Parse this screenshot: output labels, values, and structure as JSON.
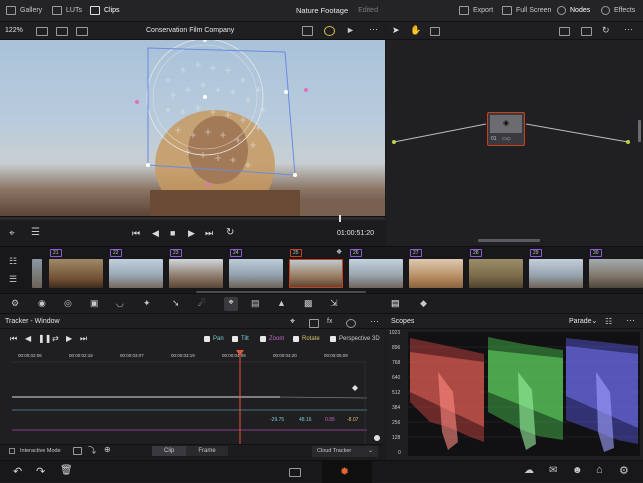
{
  "topbar": {
    "gallery": "Gallery",
    "luts": "LUTs",
    "clips": "Clips",
    "project_title": "Nature Footage",
    "project_status": "Edited",
    "export": "Export",
    "fullscreen": "Full Screen",
    "nodes": "Nodes",
    "effects": "Effects"
  },
  "viewer": {
    "zoom": "122%",
    "clip_name": "Conservation Film Company",
    "timecode": "01:00:51:20"
  },
  "clips": [
    {
      "num": "21"
    },
    {
      "num": "22"
    },
    {
      "num": "23"
    },
    {
      "num": "24"
    },
    {
      "num": "25"
    },
    {
      "num": "26"
    },
    {
      "num": "27"
    },
    {
      "num": "28"
    },
    {
      "num": "29"
    },
    {
      "num": "30"
    }
  ],
  "node": {
    "label": "01"
  },
  "tracker": {
    "title": "Tracker - Window",
    "opts": {
      "pan": "Pan",
      "tilt": "Tilt",
      "zoom": "Zoom",
      "rotate": "Rotate",
      "perspective": "Perspective 3D"
    },
    "ruler": [
      "00:00:02:06",
      "00:00:02:18",
      "00:00:03:07",
      "00:00:03:19",
      "00:00:04:08",
      "00:00:04:20",
      "00:00:05:09"
    ],
    "values": {
      "v1": "-29.75",
      "v2": "48.16",
      "v3": "0.95",
      "v4": "-8.07"
    },
    "interactive": "Interactive Mode",
    "clip_tab": "Clip",
    "frame_tab": "Frame",
    "cloud_tracker": "Cloud Tracker"
  },
  "scopes": {
    "title": "Scopes",
    "mode": "Parade",
    "scale": [
      "1023",
      "896",
      "768",
      "640",
      "512",
      "384",
      "256",
      "128",
      "0"
    ]
  },
  "colors": {
    "accent": "#c8401d",
    "purple": "#8a5bd6",
    "playhead": "#e0563a"
  }
}
